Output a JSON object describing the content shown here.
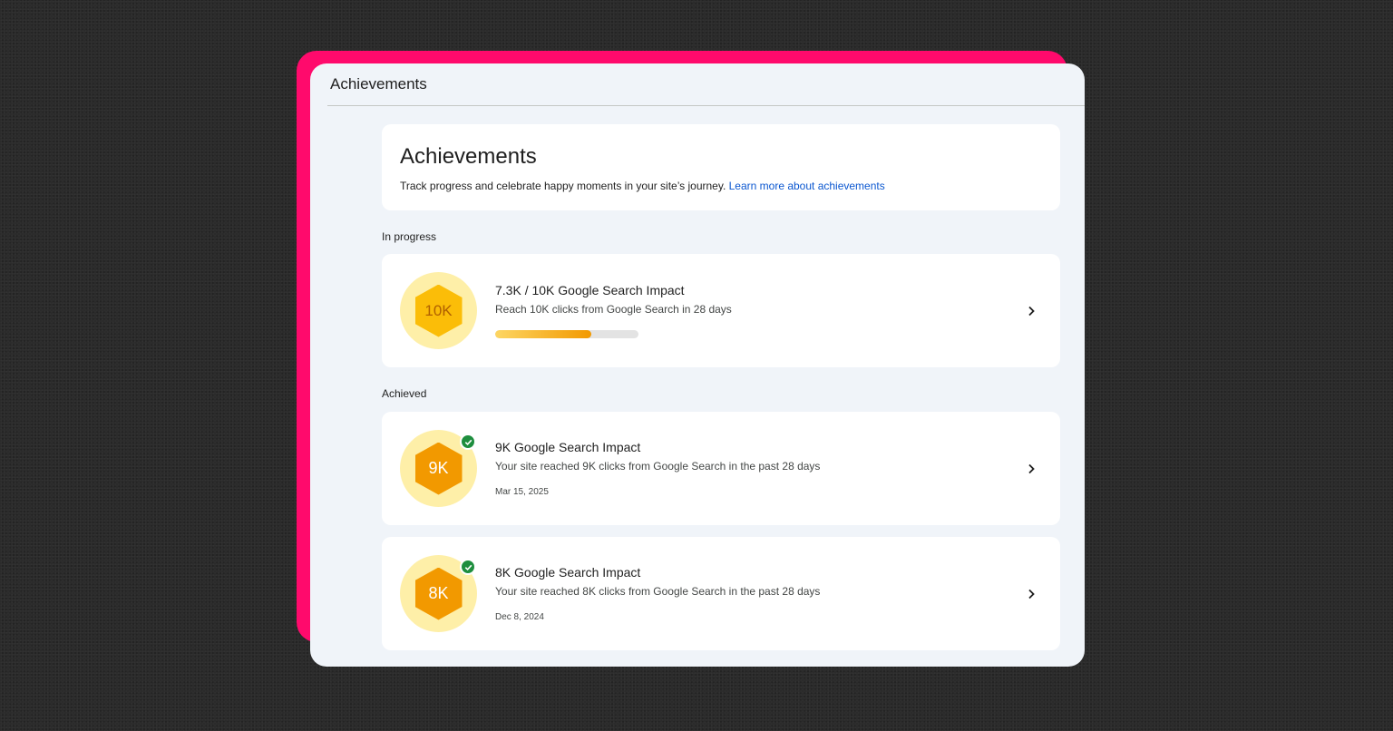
{
  "window": {
    "title": "Achievements"
  },
  "intro": {
    "title": "Achievements",
    "description": "Track progress and celebrate happy moments in your site’s journey. ",
    "link_text": "Learn more about achievements"
  },
  "sections": {
    "in_progress": "In progress",
    "achieved": "Achieved"
  },
  "in_progress": [
    {
      "badge": "10K",
      "title": "7.3K / 10K Google Search Impact",
      "description": "Reach 10K clicks from Google Search in 28 days",
      "progress_fraction": 0.67
    }
  ],
  "achieved": [
    {
      "badge": "9K",
      "title": "9K Google Search Impact",
      "description": "Your site reached 9K clicks from Google Search in the past 28 days",
      "date": "Mar 15, 2025"
    },
    {
      "badge": "8K",
      "title": "8K Google Search Impact",
      "description": "Your site reached 8K clicks from Google Search in the past 28 days",
      "date": "Dec 8, 2024"
    }
  ],
  "icons": {
    "chevron": "chevron-right-icon",
    "check": "check-circle-icon",
    "badge": "hexagon-badge-icon"
  },
  "colors": {
    "accent": "#ff0a6c",
    "link": "#0b57d0",
    "badge_bg": "#feefa8",
    "badge_hex": "#f29900",
    "check": "#1e8e3e"
  }
}
